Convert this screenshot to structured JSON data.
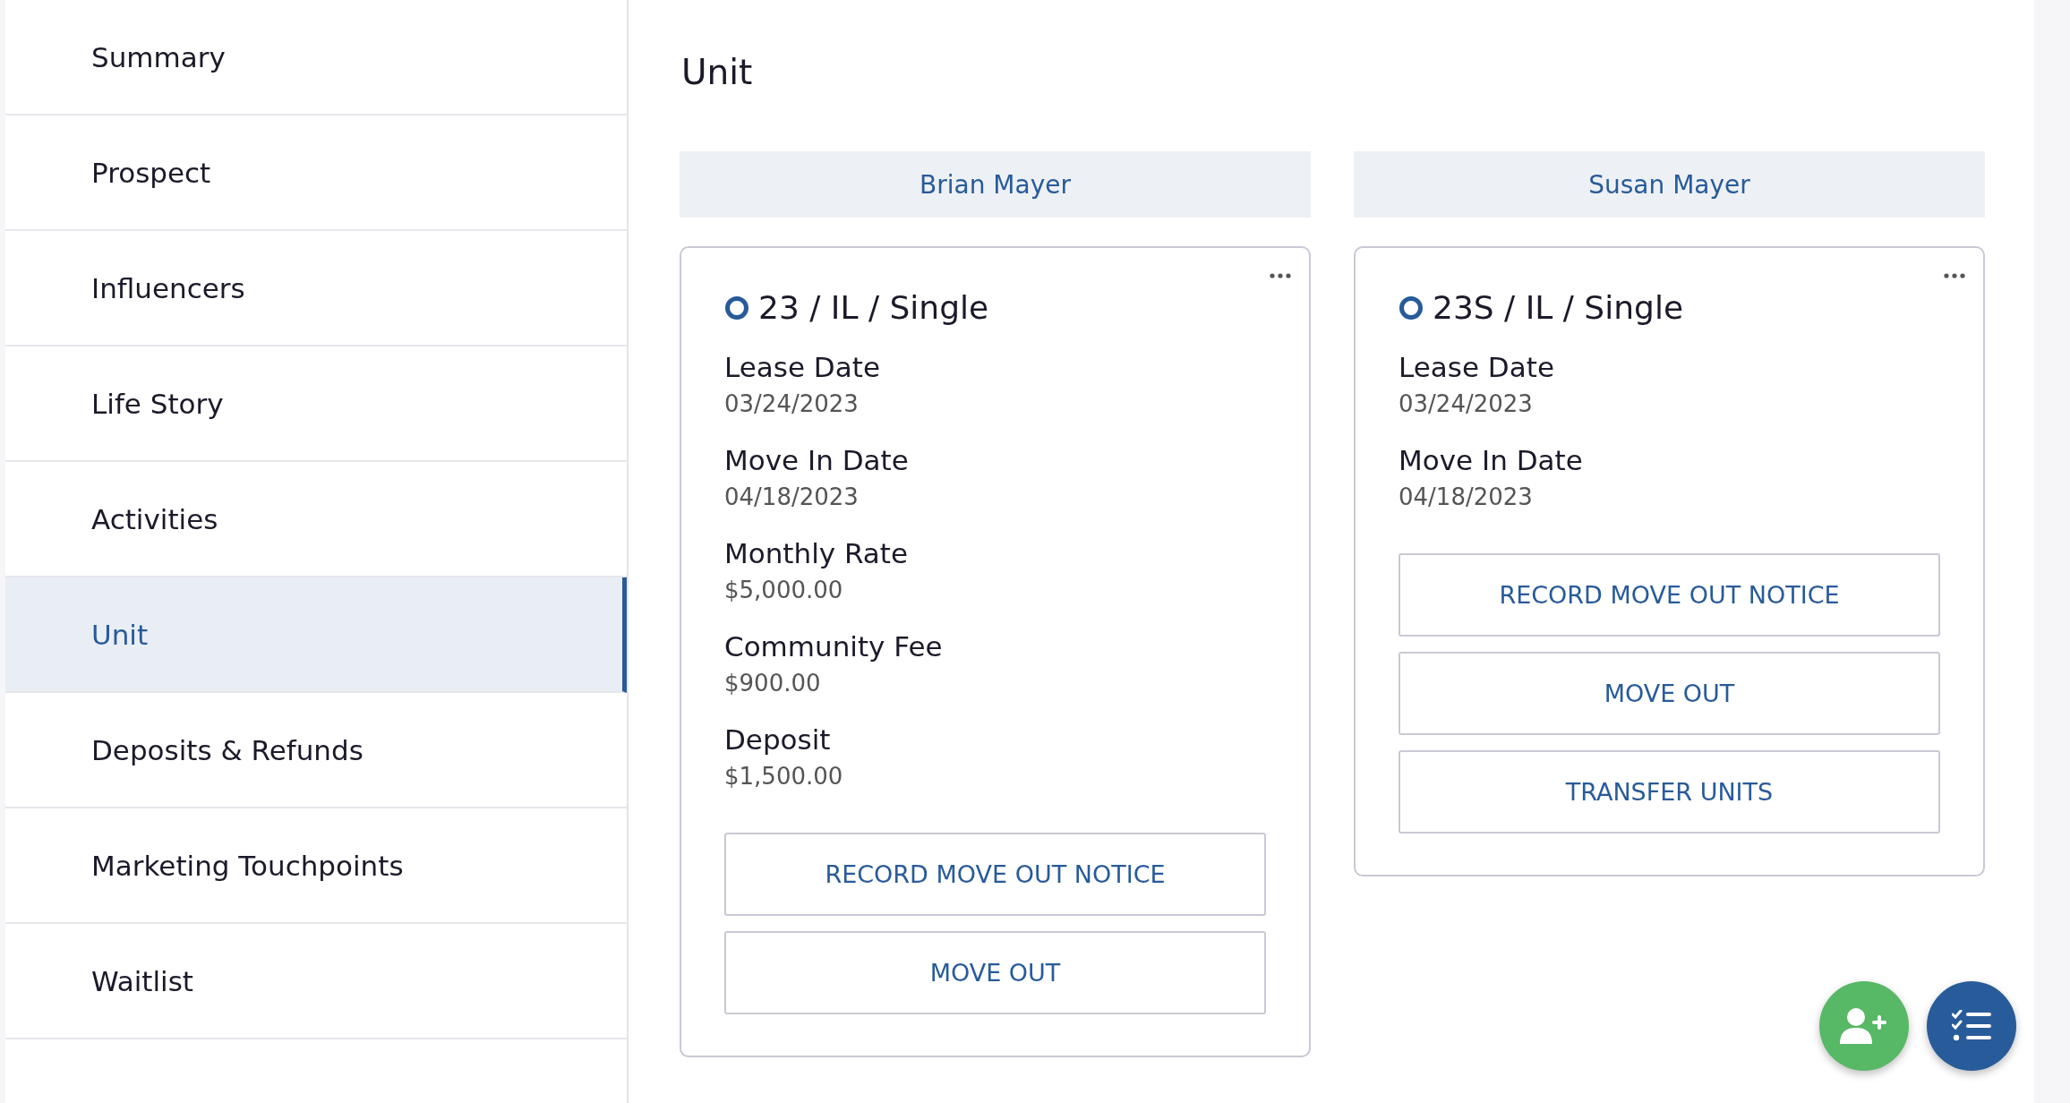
{
  "sidebar": {
    "items": [
      {
        "label": "Summary",
        "selected": false
      },
      {
        "label": "Prospect",
        "selected": false
      },
      {
        "label": "Influencers",
        "selected": false
      },
      {
        "label": "Life Story",
        "selected": false
      },
      {
        "label": "Activities",
        "selected": false
      },
      {
        "label": "Unit",
        "selected": true
      },
      {
        "label": "Deposits & Refunds",
        "selected": false
      },
      {
        "label": "Marketing Touchpoints",
        "selected": false
      },
      {
        "label": "Waitlist",
        "selected": false
      }
    ]
  },
  "page_title": "Unit",
  "residents": [
    {
      "name": "Brian Mayer",
      "unit": {
        "title": "23 / IL / Single",
        "fields": [
          {
            "label": "Lease Date",
            "value": "03/24/2023"
          },
          {
            "label": "Move In Date",
            "value": "04/18/2023"
          },
          {
            "label": "Monthly Rate",
            "value": "$5,000.00"
          },
          {
            "label": "Community Fee",
            "value": "$900.00"
          },
          {
            "label": "Deposit",
            "value": "$1,500.00"
          }
        ],
        "buttons": [
          "RECORD MOVE OUT NOTICE",
          "MOVE OUT"
        ]
      }
    },
    {
      "name": "Susan Mayer",
      "unit": {
        "title": "23S / IL / Single",
        "fields": [
          {
            "label": "Lease Date",
            "value": "03/24/2023"
          },
          {
            "label": "Move In Date",
            "value": "04/18/2023"
          }
        ],
        "buttons": [
          "RECORD MOVE OUT NOTICE",
          "MOVE OUT",
          "TRANSFER UNITS"
        ]
      }
    }
  ],
  "fab_buttons": [
    {
      "kind": "add-person",
      "color": "#57b866"
    },
    {
      "kind": "checklist",
      "color": "#285b99"
    }
  ]
}
